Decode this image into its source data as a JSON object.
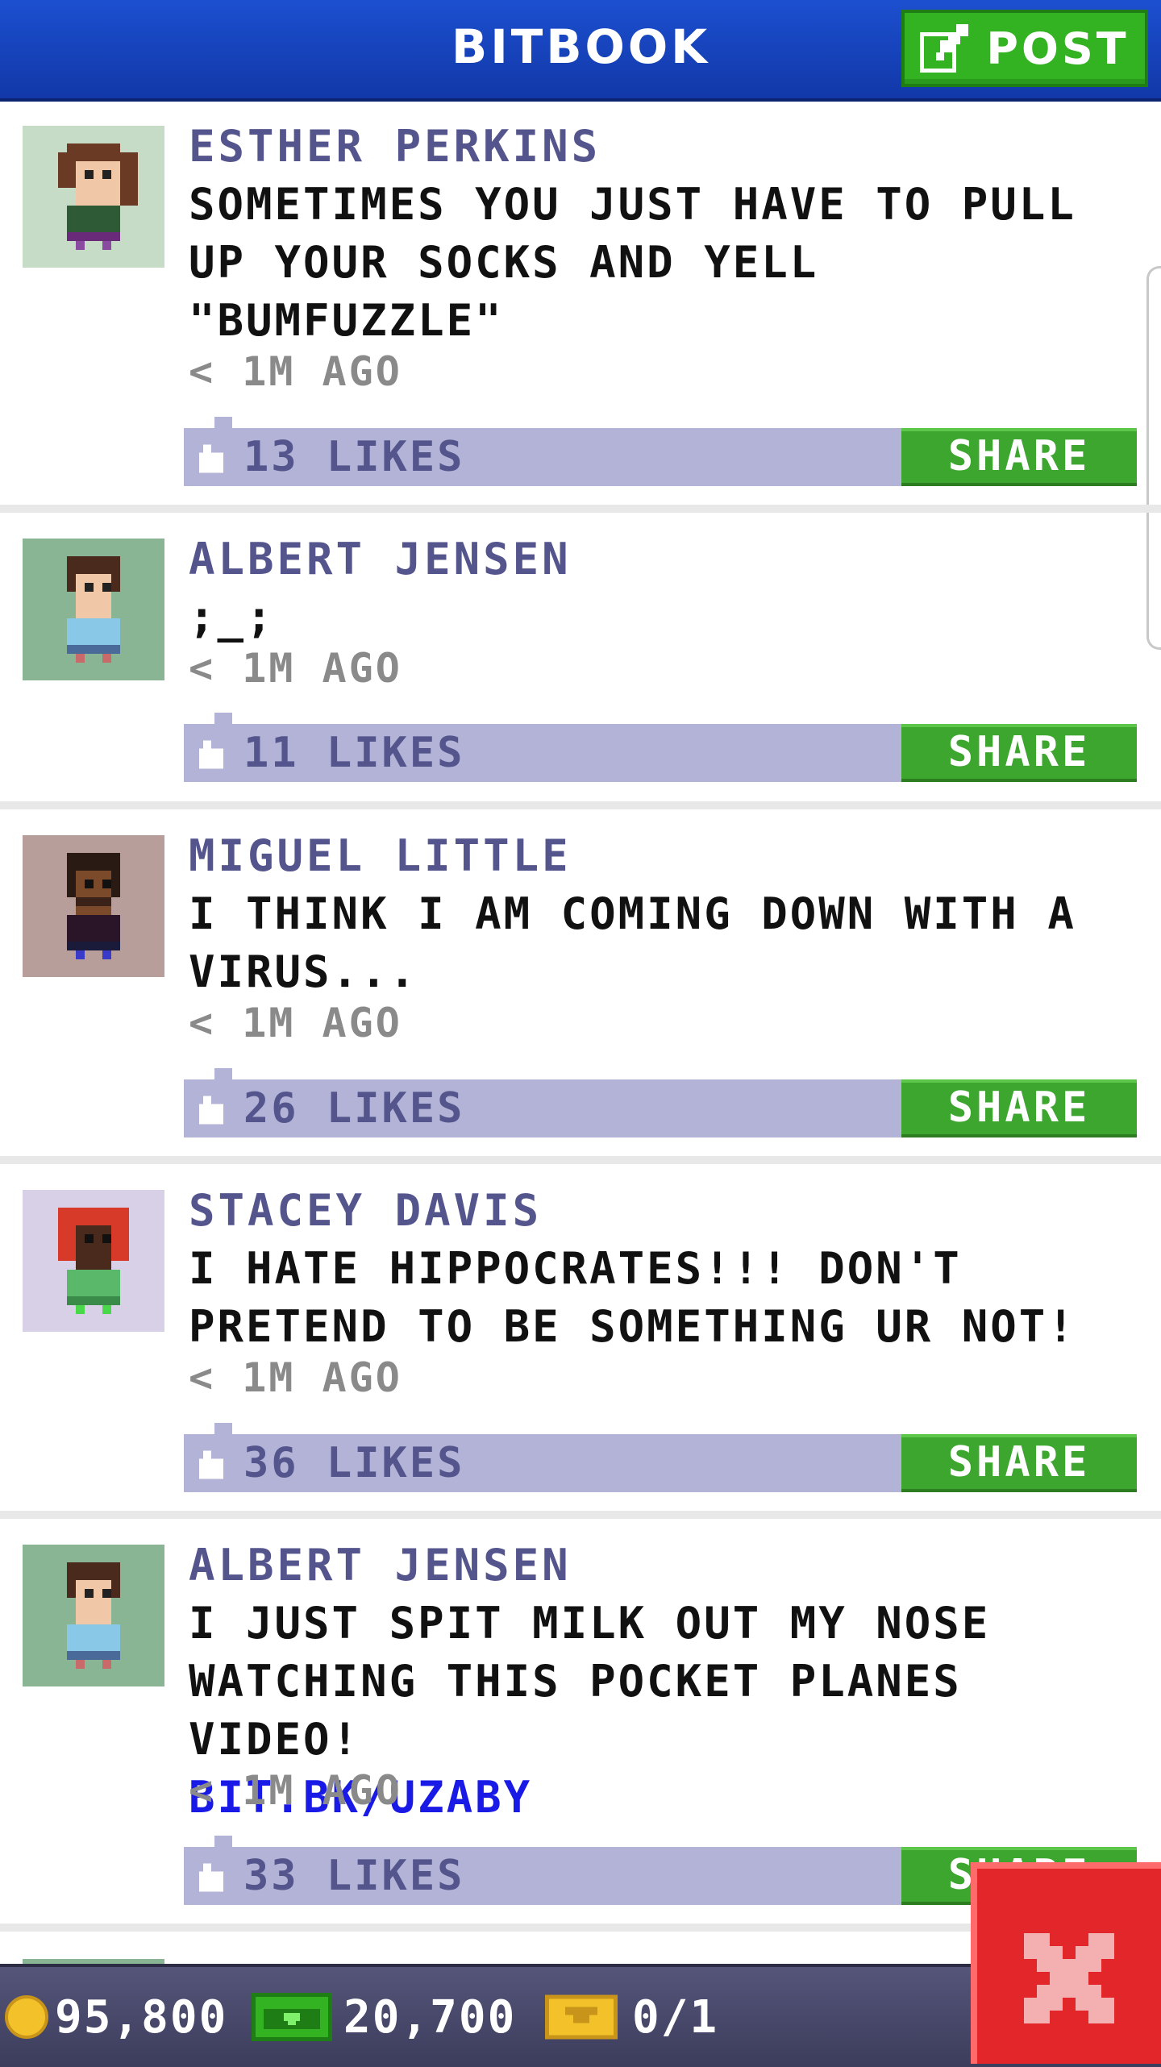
{
  "header": {
    "title": "BITBOOK",
    "post_label": "POST"
  },
  "posts": [
    {
      "author": "ESTHER PERKINS",
      "message": "SOMETIMES YOU JUST HAVE TO PULL UP YOUR SOCKS AND YELL \"BUMFUZZLE\"",
      "link": "",
      "time": "< 1M AGO",
      "likes": "13 LIKES",
      "share_label": "SHARE",
      "avatar_bg": "#c6dcc6"
    },
    {
      "author": "ALBERT JENSEN",
      "message": ";_;",
      "link": "",
      "time": "< 1M AGO",
      "likes": "11 LIKES",
      "share_label": "SHARE",
      "avatar_bg": "#8ab594"
    },
    {
      "author": "MIGUEL LITTLE",
      "message": "I THINK I AM COMING DOWN WITH A VIRUS...",
      "link": "",
      "time": "< 1M AGO",
      "likes": "26 LIKES",
      "share_label": "SHARE",
      "avatar_bg": "#b89e9a"
    },
    {
      "author": "STACEY DAVIS",
      "message": "I HATE HIPPOCRATES!!! DON'T PRETEND TO BE SOMETHING UR NOT!",
      "link": "",
      "time": "< 1M AGO",
      "likes": "36 LIKES",
      "share_label": "SHARE",
      "avatar_bg": "#d8d0e6"
    },
    {
      "author": "ALBERT JENSEN",
      "message": "I JUST SPIT MILK OUT MY NOSE WATCHING THIS POCKET PLANES VIDEO!",
      "link": "BIT.BK/UZABY",
      "time": "< 1M AGO",
      "likes": "33 LIKES",
      "share_label": "SHARE",
      "avatar_bg": "#8ab594"
    }
  ],
  "footer": {
    "coins": "95,800",
    "bux": "20,700",
    "tickets": "0/1"
  },
  "colors": {
    "header": "#1c4fd0",
    "accent_green": "#3da62e",
    "likes_bar": "#b3b3d8",
    "author_text": "#55558d",
    "link": "#1a1ae6",
    "close_red": "#e2262a"
  }
}
